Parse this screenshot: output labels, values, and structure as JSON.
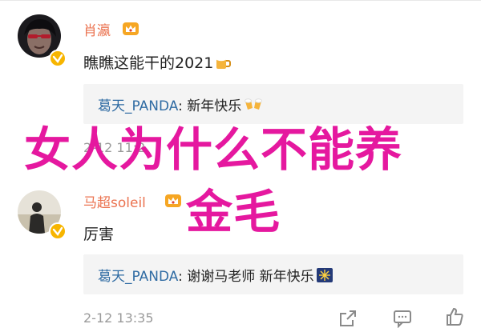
{
  "comments": [
    {
      "username": "肖瀛",
      "text": "瞧瞧这能干的2021",
      "text_emoji_icon": "beer-mug-icon",
      "reply": {
        "user": "葛天_PANDA",
        "separator": ": ",
        "text": "新年快乐",
        "emoji_icon": "cheers-icon"
      },
      "time": "2-12 11:2"
    },
    {
      "username": "马超soleil",
      "text": "厉害",
      "reply": {
        "user": "葛天_PANDA",
        "separator": ": ",
        "text": "谢谢马老师 新年快乐",
        "emoji_icon": "fireworks-icon"
      },
      "time": "2-12 13:35"
    }
  ],
  "overlay": {
    "line1": "女人为什么不能养",
    "line2": "金毛"
  },
  "colors": {
    "username": "#eb7350",
    "reply_user": "#2f6ba3",
    "overlay": "#e5189f",
    "verified_badge": "#f7b500"
  }
}
